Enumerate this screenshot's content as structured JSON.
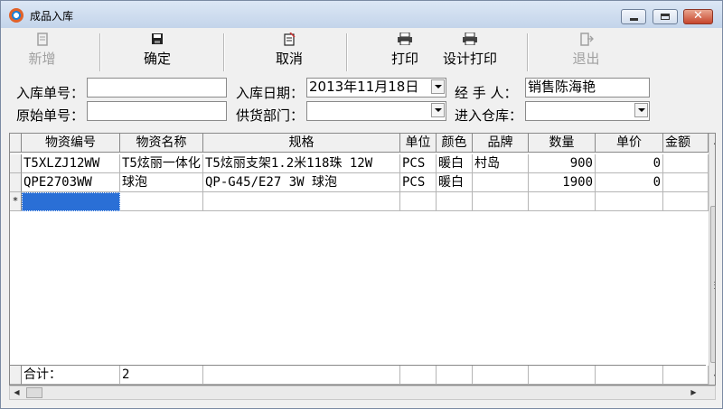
{
  "window": {
    "title": "成品入库",
    "controls": {
      "minimize_icon": "minimize-icon",
      "maximize_icon": "maximize-icon",
      "close_label": "✕"
    }
  },
  "toolbar": {
    "new_label": "新增",
    "confirm_label": "确定",
    "cancel_label": "取消",
    "print_label": "打印",
    "design_print_label": "设计打印",
    "exit_label": "退出",
    "icons": {
      "new": "new-doc-icon",
      "confirm": "floppy-save-icon",
      "cancel": "cancel-doc-icon",
      "print": "printer-icon",
      "design_print": "printer-icon",
      "exit": "exit-door-icon"
    }
  },
  "form": {
    "receipt_no_label": "入库单号：",
    "receipt_no_value": "",
    "original_no_label": "原始单号：",
    "original_no_value": "",
    "date_label": "入库日期：",
    "date_value": "2013年11月18日",
    "supplier_label": "供货部门：",
    "supplier_value": "",
    "handler_label": "经 手 人：",
    "handler_value": "销售陈海艳",
    "warehouse_label": "进入仓库：",
    "warehouse_value": ""
  },
  "grid": {
    "columns": [
      "物资编号",
      "物资名称",
      "规格",
      "单位",
      "颜色",
      "品牌",
      "数量",
      "单价",
      "金额"
    ],
    "rows": [
      [
        "T5XLZJ12WW",
        "T5炫丽一体化",
        "T5炫丽支架1.2米118珠 12W",
        "PCS",
        "暖白",
        "村岛",
        "900",
        "0",
        ""
      ],
      [
        "QPE2703WW",
        "球泡",
        "QP-G45/E27 3W 球泡",
        "PCS",
        "暖白",
        "",
        "1900",
        "0",
        ""
      ]
    ],
    "new_row_marker": "*",
    "total_label": "合计：",
    "total_count": "2"
  },
  "colors": {
    "selection": "#2a6fd6",
    "titlebar": "#c3d4ea",
    "close_button": "#c6452c"
  }
}
